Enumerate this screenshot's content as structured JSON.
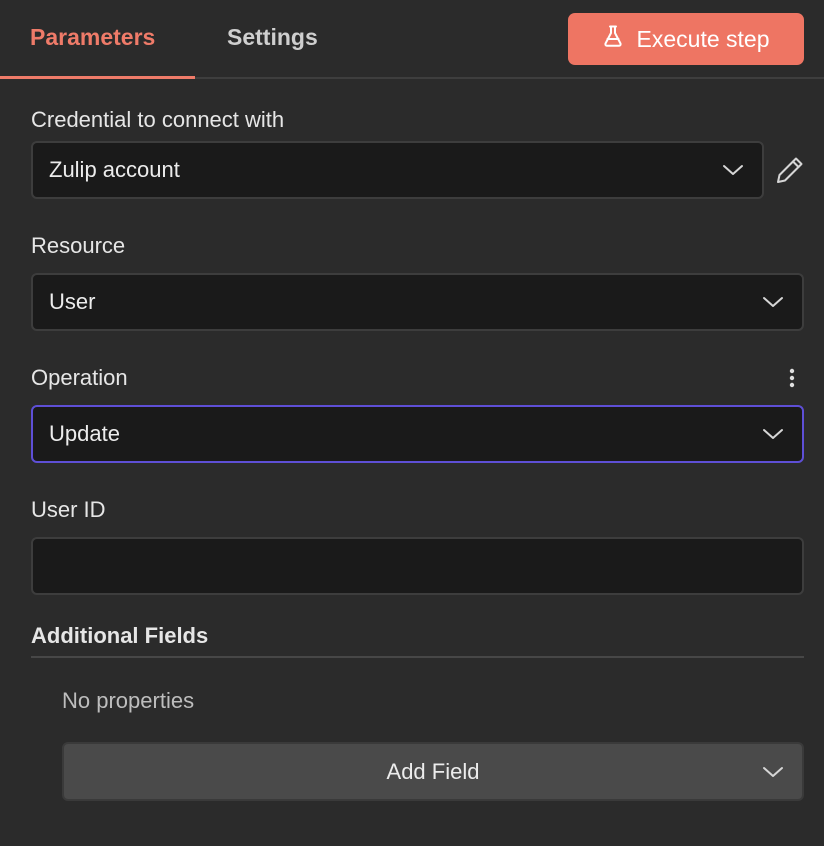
{
  "tabs": {
    "parameters": "Parameters",
    "settings": "Settings"
  },
  "execute_button": {
    "label": "Execute step",
    "icon": "flask-icon",
    "color": "#ee7563"
  },
  "fields": {
    "credential": {
      "label": "Credential to connect with",
      "value": "Zulip account",
      "icon": "pencil-icon"
    },
    "resource": {
      "label": "Resource",
      "value": "User"
    },
    "operation": {
      "label": "Operation",
      "value": "Update",
      "focused_border_color": "#5e4fd6"
    },
    "user_id": {
      "label": "User ID",
      "value": ""
    }
  },
  "additional_fields": {
    "title": "Additional Fields",
    "empty_text": "No properties",
    "add_button": "Add Field"
  },
  "accent_color": "#ef7b69"
}
